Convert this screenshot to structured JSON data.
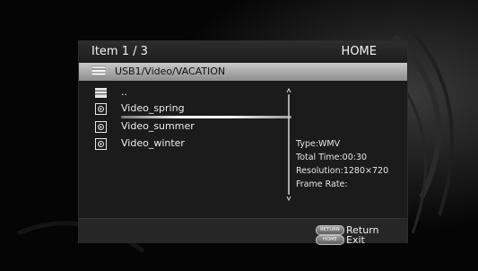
{
  "header": {
    "item_counter": "Item 1 / 3",
    "menu_title": "HOME"
  },
  "path_bar": {
    "icon": "folder-icon",
    "path": "USB1/Video/VACATION"
  },
  "file_list": [
    {
      "label": "..",
      "icon": "parent-folder-icon",
      "selected": false
    },
    {
      "label": "Video_spring",
      "icon": "video-file-icon",
      "selected": true
    },
    {
      "label": "Video_summer",
      "icon": "video-file-icon",
      "selected": false
    },
    {
      "label": "Video_winter",
      "icon": "video-file-icon",
      "selected": false
    }
  ],
  "info": {
    "type": "Type:WMV",
    "total_time": "Total Time:00:30",
    "resolution": "Resolution:1280×720",
    "frame_rate": "Frame Rate:"
  },
  "footer": {
    "return_key": "RETURN",
    "return_label": "Return",
    "home_key": "HOME",
    "exit_label": "Exit"
  },
  "colors": {
    "panel_bg": "#1b1b1b",
    "path_bar": "#b5b5b5",
    "text": "#f0f0f0"
  }
}
